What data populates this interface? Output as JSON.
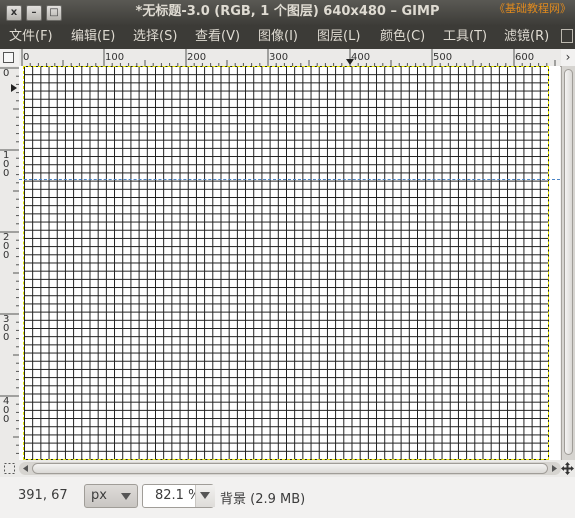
{
  "window": {
    "title": "*无标题-3.0 (RGB, 1 个图层) 640x480 – GIMP",
    "watermark": "《基础教程网》",
    "close_label": "x",
    "minimize_label": "–",
    "maximize_label": "□"
  },
  "menubar": {
    "items": [
      {
        "label": "文件(F)"
      },
      {
        "label": "编辑(E)"
      },
      {
        "label": "选择(S)"
      },
      {
        "label": "查看(V)"
      },
      {
        "label": "图像(I)"
      },
      {
        "label": "图层(L)"
      },
      {
        "label": "颜色(C)"
      },
      {
        "label": "工具(T)"
      },
      {
        "label": "滤镜(R)"
      }
    ]
  },
  "rulers": {
    "top_ticks": [
      "0",
      "100",
      "200",
      "300",
      "400",
      "500",
      "600"
    ],
    "left_ticks": [
      "0",
      "100",
      "200",
      "300",
      "400"
    ]
  },
  "statusbar": {
    "coordinates": "391, 67",
    "unit": "px",
    "zoom": "82.1 %",
    "message": "背景 (2.9 MB)"
  },
  "colors": {
    "titlebar": "#3c3b37",
    "menubar": "#3c3b37",
    "menu_text": "#dfdbd2",
    "grid_line": "#1b1b1b",
    "selection_border": "#e6e600",
    "guide": "#4a84c5",
    "watermark": "#e08a1e"
  }
}
